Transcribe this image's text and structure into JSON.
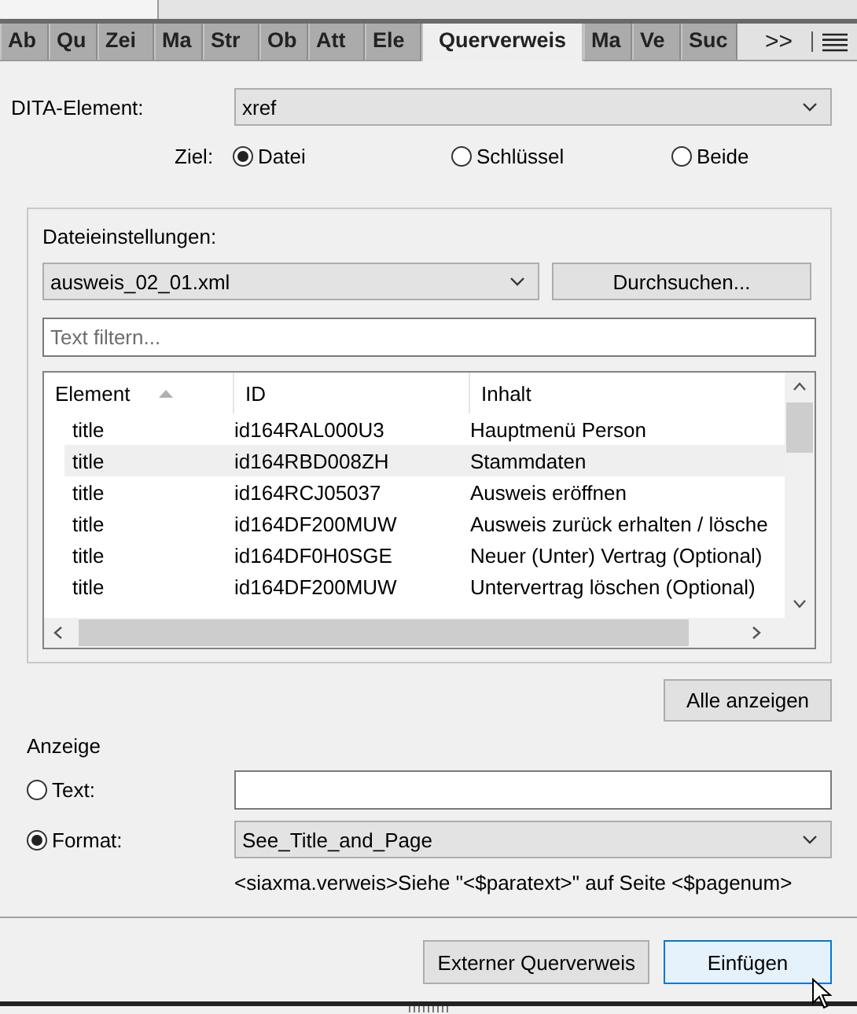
{
  "tabs": [
    {
      "label": "Ab",
      "selected": false
    },
    {
      "label": "Qu",
      "selected": false
    },
    {
      "label": "Zei",
      "selected": false
    },
    {
      "label": "Ma",
      "selected": false
    },
    {
      "label": "Str",
      "selected": false
    },
    {
      "label": "Ob",
      "selected": false
    },
    {
      "label": "Att",
      "selected": false
    },
    {
      "label": "Ele",
      "selected": false
    },
    {
      "label": "Querverweis",
      "selected": true
    },
    {
      "label": "Ma",
      "selected": false
    },
    {
      "label": "Ve",
      "selected": false
    },
    {
      "label": "Suc",
      "selected": false
    }
  ],
  "tab_overflow": ">>",
  "dita_element": {
    "label": "DITA-Element:",
    "value": "xref"
  },
  "target": {
    "label": "Ziel:",
    "options": [
      {
        "label": "Datei",
        "selected": true
      },
      {
        "label": "Schlüssel",
        "selected": false
      },
      {
        "label": "Beide",
        "selected": false
      }
    ]
  },
  "file_settings": {
    "title": "Dateieinstellungen:",
    "file": "ausweis_02_01.xml",
    "browse_button": "Durchsuchen...",
    "filter": {
      "placeholder": "Text filtern..."
    },
    "table": {
      "columns": [
        {
          "label": "Element",
          "sorted": true
        },
        {
          "label": "ID",
          "sorted": false
        },
        {
          "label": "Inhalt",
          "sorted": false
        }
      ],
      "rows": [
        {
          "cells": [
            "title",
            "id164RAL000U3",
            "Hauptmenü Person"
          ],
          "selected": false
        },
        {
          "cells": [
            "title",
            "id164RBD008ZH",
            "Stammdaten"
          ],
          "selected": true
        },
        {
          "cells": [
            "title",
            "id164RCJ05037",
            "Ausweis eröffnen"
          ],
          "selected": false
        },
        {
          "cells": [
            "title",
            "id164DF200MUW",
            "Ausweis zurück erhalten / lösche"
          ],
          "selected": false
        },
        {
          "cells": [
            "title",
            "id164DF0H0SGE",
            "Neuer (Unter) Vertrag (Optional)"
          ],
          "selected": false
        },
        {
          "cells": [
            "title",
            "id164DF200MUW",
            "Untervertrag löschen (Optional)"
          ],
          "selected": false
        }
      ]
    }
  },
  "show_all_button": "Alle anzeigen",
  "display": {
    "title": "Anzeige",
    "options": [
      {
        "kind": "text",
        "label": "Text:",
        "selected": false
      },
      {
        "kind": "format",
        "label": "Format:",
        "selected": true,
        "value": "See_Title_and_Page"
      }
    ],
    "format_preview": "<siaxma.verweis>Siehe \"<$paratext>\" auf Seite <$pagenum>"
  },
  "buttons": [
    {
      "label": "Externer Querverweis",
      "focused": false
    },
    {
      "label": "Einfügen",
      "focused": true
    }
  ]
}
